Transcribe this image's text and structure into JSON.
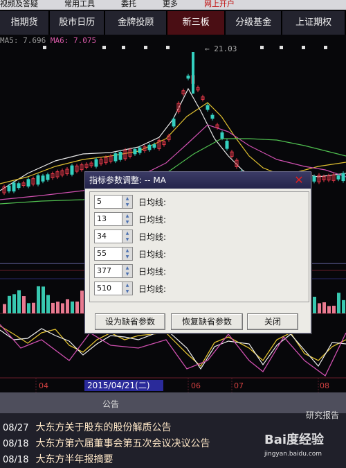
{
  "menu": {
    "items": [
      "视频及答疑",
      "常用工具",
      "委托",
      "更多",
      "网上开户"
    ]
  },
  "tabs": [
    {
      "label": "指期货",
      "active": false
    },
    {
      "label": "股市日历",
      "active": false
    },
    {
      "label": "金牌投顾",
      "active": false
    },
    {
      "label": "新三板",
      "active": true
    },
    {
      "label": "分级基金",
      "active": false
    },
    {
      "label": "上证期权",
      "active": false
    }
  ],
  "ma_readout": {
    "prefix": "MA5: 7.696",
    "ma6": "MA6: 7.075"
  },
  "peak_label": "← 21.03",
  "dialog": {
    "title": "指标参数调整: -- MA",
    "close_icon": "close-icon",
    "params": [
      {
        "value": "5",
        "label": "日均线:"
      },
      {
        "value": "13",
        "label": "日均线:"
      },
      {
        "value": "34",
        "label": "日均线:"
      },
      {
        "value": "55",
        "label": "日均线:"
      },
      {
        "value": "377",
        "label": "日均线:"
      },
      {
        "value": "510",
        "label": "日均线:"
      }
    ],
    "buttons": {
      "set_default": "设为缺省参数",
      "restore_default": "恢复缺省参数",
      "close": "关闭"
    }
  },
  "date_axis": {
    "labels": [
      "04",
      "06",
      "07",
      "08"
    ],
    "current": "2015/04/21(二)"
  },
  "announcements": {
    "header": "公告",
    "research": "研究报告",
    "items": [
      {
        "date": "08/27",
        "text": "大东方关于股东的股份解质公告"
      },
      {
        "date": "08/18",
        "text": "大东方第六届董事会第五次会议决议公告"
      },
      {
        "date": "08/18",
        "text": "大东方半年报摘要"
      }
    ]
  },
  "watermark": {
    "logo": "Bai度经验",
    "url": "jingyan.baidu.com"
  },
  "colors": {
    "background": "#07070a",
    "up": "#e83a4a",
    "down": "#34d0c0",
    "ma_white": "#e8e8e8",
    "ma_yellow": "#e0c030",
    "ma_magenta": "#d050b0",
    "ma_green": "#50c050",
    "tab_active": "#4a0e14"
  }
}
